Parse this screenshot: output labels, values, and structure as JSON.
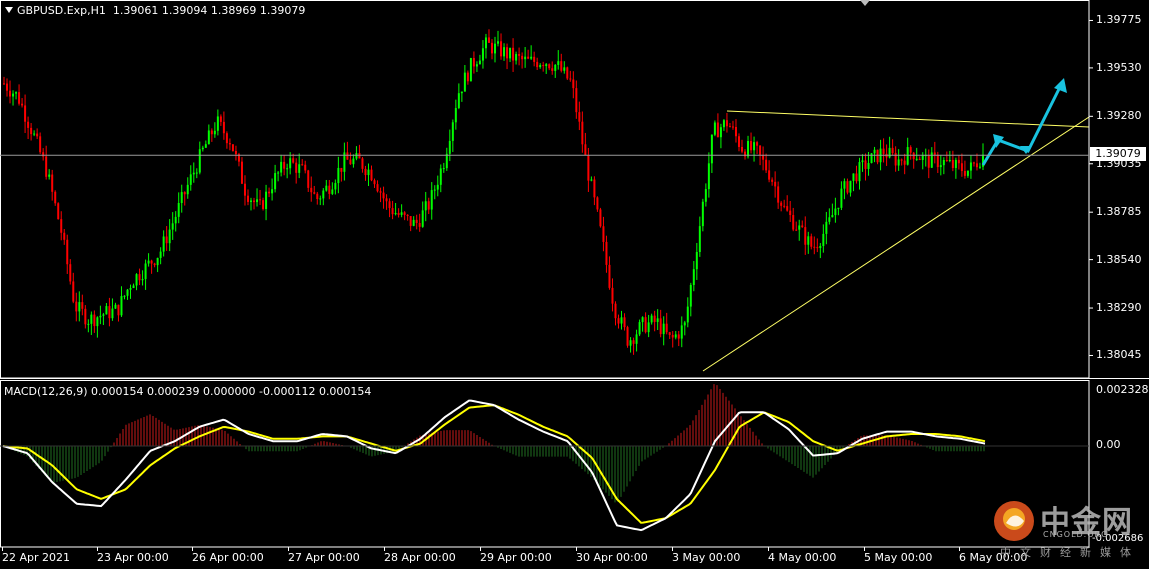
{
  "header": {
    "symbol": "GBPUSD.Exp,H1",
    "ohlc": "1.39061 1.39094 1.38969 1.39079"
  },
  "macd": {
    "label": "MACD(12,26,9) 0.000154 0.000239 0.000000 -0.000112 0.000154",
    "axis_ticks": [
      "0.002328",
      "0.00",
      "-0.002686"
    ]
  },
  "price_axis": {
    "ticks": [
      "1.39775",
      "1.39530",
      "1.39280",
      "1.39035",
      "1.38785",
      "1.38540",
      "1.38290",
      "1.38045"
    ],
    "current": "1.39079"
  },
  "time_axis": {
    "ticks": [
      "22 Apr 2021",
      "23 Apr 00:00",
      "26 Apr 00:00",
      "27 Apr 00:00",
      "28 Apr 00:00",
      "29 Apr 00:00",
      "30 Apr 00:00",
      "3 May 00:00",
      "4 May 00:00",
      "5 May 00:00",
      "6 May 00:00"
    ]
  },
  "watermark": {
    "cn": "中金网",
    "en": "CNGOLD.ORG",
    "sub": "中文财经新媒体"
  },
  "colors": {
    "bull": "#00ff00",
    "bear": "#ff0000",
    "macd_main": "#ffffff",
    "macd_signal": "#ffff00",
    "hist_pos": "#c81a1a",
    "hist_neg": "#1f6e1f",
    "trend": "#ffff66",
    "arrow": "#19c3e0"
  },
  "chart_data": {
    "type": "candlestick",
    "title": "GBPUSD.Exp,H1",
    "ylim": [
      1.3797,
      1.3986
    ],
    "current_price": 1.39079,
    "days": [
      "22 Apr 2021",
      "23 Apr 00:00",
      "26 Apr 00:00",
      "27 Apr 00:00",
      "28 Apr 00:00",
      "29 Apr 00:00",
      "30 Apr 00:00",
      "3 May 00:00",
      "4 May 00:00",
      "5 May 00:00",
      "6 May 00:00"
    ],
    "close_path": [
      1.3945,
      1.3938,
      1.392,
      1.39,
      1.387,
      1.383,
      1.3823,
      1.3826,
      1.3828,
      1.3843,
      1.385,
      1.3858,
      1.3875,
      1.3893,
      1.391,
      1.3925,
      1.3915,
      1.389,
      1.388,
      1.3895,
      1.3905,
      1.39,
      1.3885,
      1.3893,
      1.3905,
      1.3905,
      1.3898,
      1.3882,
      1.3876,
      1.3872,
      1.3883,
      1.3905,
      1.394,
      1.3955,
      1.3965,
      1.3962,
      1.3958,
      1.3956,
      1.3957,
      1.3954,
      1.3945,
      1.3905,
      1.387,
      1.383,
      1.3812,
      1.382,
      1.3822,
      1.3812,
      1.382,
      1.387,
      1.392,
      1.3925,
      1.3912,
      1.391,
      1.3898,
      1.388,
      1.387,
      1.386,
      1.387,
      1.3888,
      1.3898,
      1.3905,
      1.391,
      1.3905,
      1.391,
      1.3905,
      1.3905,
      1.3902,
      1.39,
      1.3908
    ],
    "macd_main": [
      0.0,
      -0.0003,
      -0.0015,
      -0.0024,
      -0.0025,
      -0.0014,
      -0.0002,
      0.0002,
      0.0008,
      0.0011,
      0.0005,
      0.0002,
      0.0002,
      0.0005,
      0.0004,
      -0.0001,
      -0.0003,
      0.0003,
      0.0012,
      0.0019,
      0.0017,
      0.0011,
      0.0006,
      0.0002,
      -0.0011,
      -0.0033,
      -0.0035,
      -0.003,
      -0.002,
      0.0002,
      0.0014,
      0.0014,
      0.0007,
      -0.0004,
      -0.0003,
      0.0003,
      0.0006,
      0.0006,
      0.0004,
      0.0003,
      0.0001
    ],
    "macd_signal": [
      0.0,
      -0.0001,
      -0.0008,
      -0.0018,
      -0.0022,
      -0.0018,
      -0.0008,
      -0.0001,
      0.0004,
      0.0008,
      0.0006,
      0.0003,
      0.0003,
      0.0004,
      0.0004,
      0.0001,
      -0.0002,
      0.0001,
      0.0009,
      0.0016,
      0.0017,
      0.0013,
      0.0008,
      0.0004,
      -0.0005,
      -0.0022,
      -0.0032,
      -0.003,
      -0.0024,
      -0.001,
      0.0008,
      0.0014,
      0.001,
      0.0002,
      -0.0002,
      0.0001,
      0.0004,
      0.0005,
      0.0005,
      0.0004,
      0.0002
    ]
  }
}
